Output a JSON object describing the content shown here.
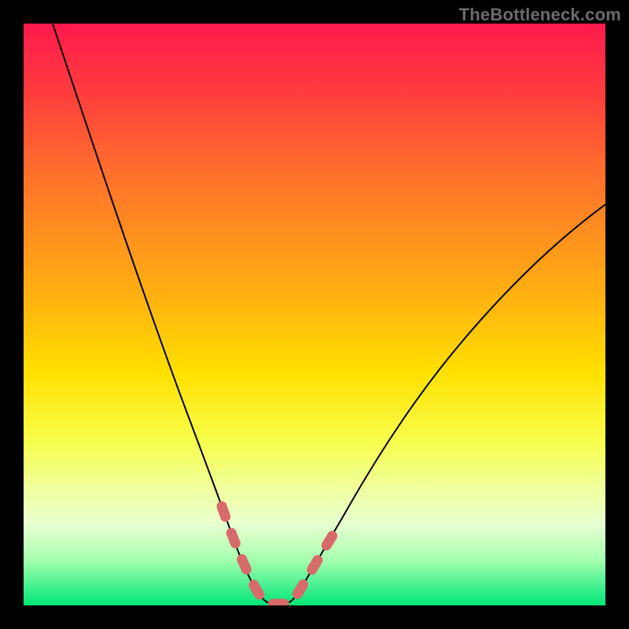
{
  "watermark": "TheBottleneck.com",
  "chart_data": {
    "type": "line",
    "title": "",
    "xlabel": "",
    "ylabel": "",
    "xlim": [
      0,
      100
    ],
    "ylim": [
      0,
      100
    ],
    "grid": false,
    "legend": false,
    "series": [
      {
        "name": "bottleneck-curve",
        "x": [
          5,
          10,
          15,
          20,
          24,
          28,
          31,
          33,
          35,
          37,
          39,
          41,
          43,
          46,
          50,
          55,
          60,
          65,
          70,
          80,
          90,
          100
        ],
        "y": [
          100,
          84,
          69,
          54,
          41,
          29,
          19,
          12,
          6,
          2,
          0,
          0,
          1,
          4,
          10,
          19,
          28,
          36,
          43,
          55,
          64,
          72
        ]
      }
    ],
    "annotations": [
      {
        "name": "pink-dash-segment",
        "x": [
          31,
          33,
          35,
          37,
          39,
          41,
          43,
          46
        ],
        "y": [
          19,
          12,
          6,
          2,
          0,
          0,
          1,
          4
        ]
      }
    ],
    "background_gradient": {
      "top": "#ff1a4d",
      "mid": "#ffe000",
      "bottom": "#00e676"
    }
  }
}
